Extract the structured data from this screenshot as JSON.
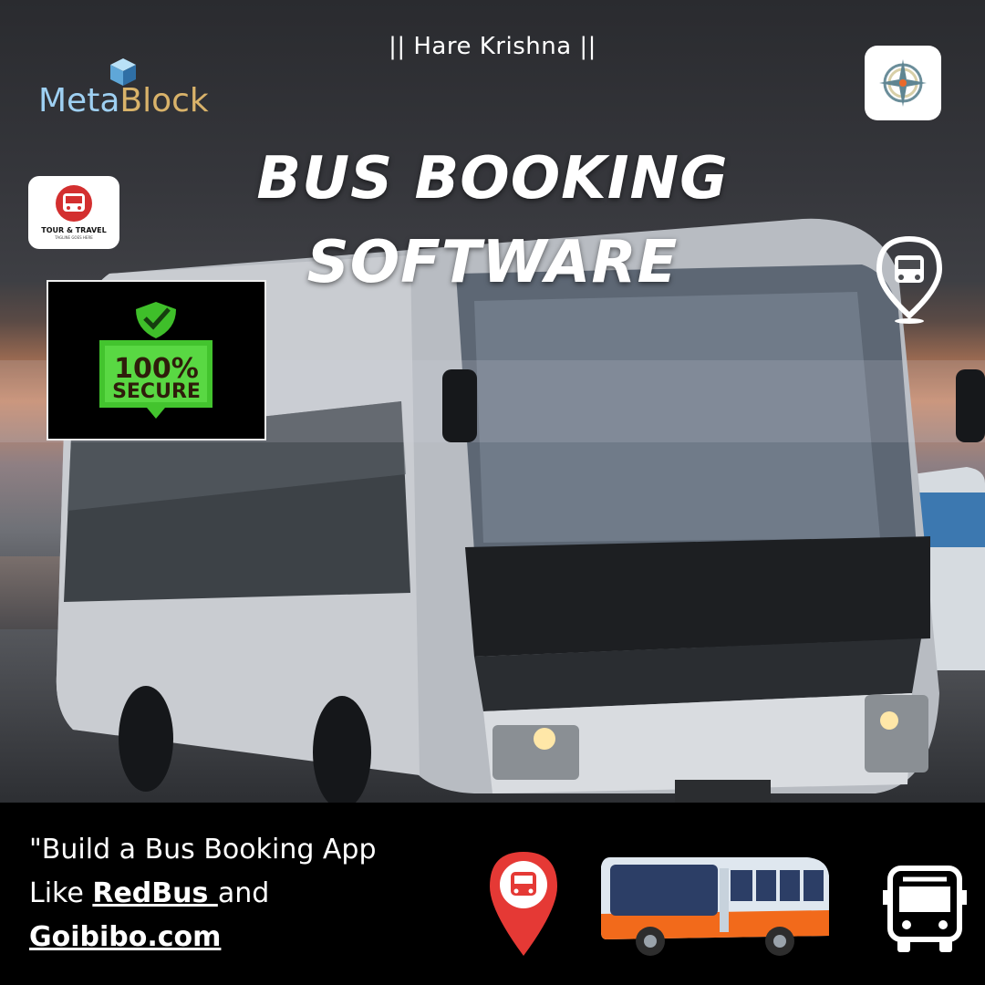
{
  "header": {
    "tagline": "|| Hare Krishna ||",
    "headline_line1": "BUS BOOKING",
    "headline_line2": "SOFTWARE"
  },
  "logo": {
    "part1": "Meta",
    "part2": "Block"
  },
  "tour_badge": {
    "title": "TOUR & TRAVEL",
    "subtitle": "TAGLINE GOES HERE"
  },
  "secure_badge": {
    "line1": "100%",
    "line2": "SECURE"
  },
  "footer": {
    "cta_line1": "\"Build a Bus Booking App",
    "cta_like": "Like ",
    "cta_redbus": "RedBus ",
    "cta_and": "and",
    "cta_goibibo": "Goibibo.com"
  },
  "icons": {
    "compass": "compass-icon",
    "location_bus": "bus-location-pin-icon",
    "red_pin": "bus-stop-pin-icon",
    "orange_bus": "bus-illustration-icon",
    "white_bus": "bus-front-icon"
  },
  "colors": {
    "logo_meta": "#9ed0f2",
    "logo_block": "#d9b36a",
    "secure_green": "#3fbf2a",
    "pin_red": "#e53935",
    "bus_orange": "#f26a1b"
  }
}
